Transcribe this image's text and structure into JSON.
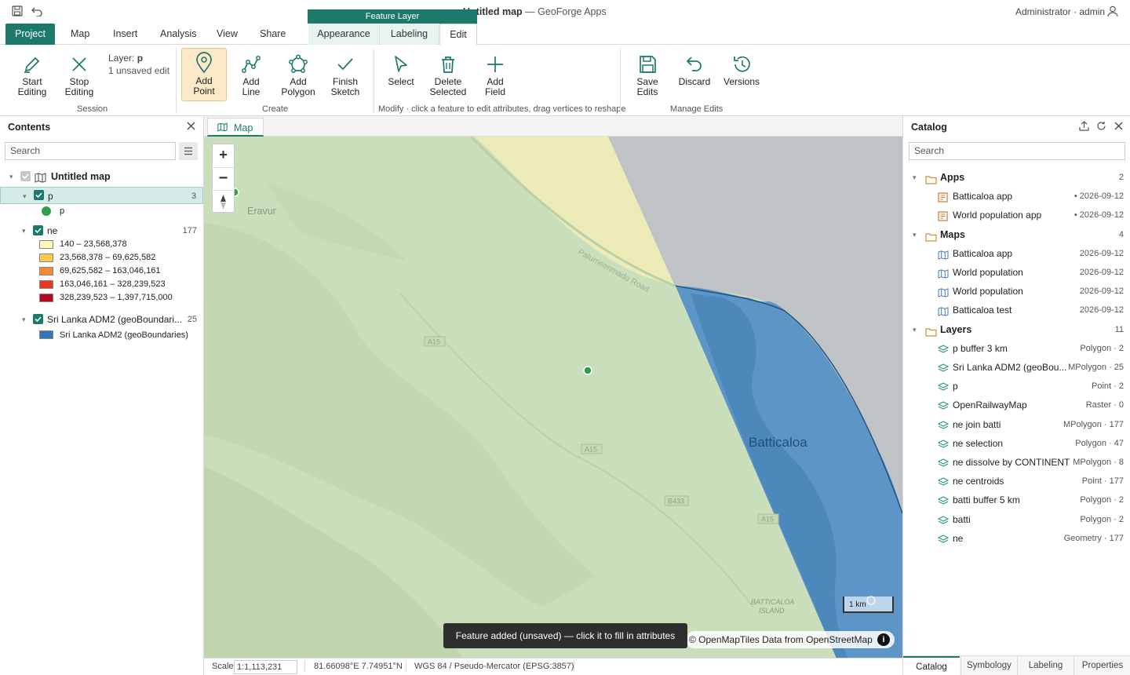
{
  "app": {
    "title_prefix": "Untitled map",
    "title_sep": " — ",
    "title_suffix": "GeoForge Apps",
    "user": "Administrator · admin"
  },
  "ribbon_tabs": [
    "Project",
    "Map",
    "Insert",
    "Analysis",
    "View",
    "Share"
  ],
  "contextual": {
    "header": "Feature Layer",
    "tabs": [
      "Appearance",
      "Labeling",
      "Edit"
    ]
  },
  "session": {
    "start": "Start\nEditing",
    "stop": "Stop\nEditing",
    "layer_label": "Layer: ",
    "layer_name": "p",
    "unsaved": "1 unsaved edit",
    "group": "Session"
  },
  "create": {
    "add_point": "Add\nPoint",
    "add_line": "Add\nLine",
    "add_polygon": "Add\nPolygon",
    "finish": "Finish\nSketch",
    "group": "Create"
  },
  "modify": {
    "select": "Select",
    "delete": "Delete\nSelected",
    "add_field": "Add\nField",
    "group": "Modify · click a feature to edit attributes, drag vertices to reshape"
  },
  "manage": {
    "save": "Save\nEdits",
    "discard": "Discard",
    "versions": "Versions",
    "group": "Manage Edits"
  },
  "contents": {
    "title": "Contents",
    "search_placeholder": "Search",
    "map_name": "Untitled map",
    "layer_p": {
      "name": "p",
      "count": "3",
      "legend": "p"
    },
    "layer_ne": {
      "name": "ne",
      "count": "177",
      "classes": [
        {
          "label": "140 – 23,568,378",
          "color": "#fff8b8"
        },
        {
          "label": "23,568,378 – 69,625,582",
          "color": "#fcc94d"
        },
        {
          "label": "69,625,582 – 163,046,161",
          "color": "#f58a35"
        },
        {
          "label": "163,046,161 – 328,239,523",
          "color": "#e8361e"
        },
        {
          "label": "328,239,523 – 1,397,715,000",
          "color": "#b4071f"
        }
      ]
    },
    "layer_adm": {
      "name": "Sri Lanka ADM2 (geoBoundari...",
      "count": "25",
      "legend": "Sri Lanka ADM2 (geoBoundaries)",
      "color": "#2f77b8"
    }
  },
  "map": {
    "tab": "Map",
    "places": {
      "eravur": "Eravur",
      "batticaloa": "Batticaloa",
      "island": "BATTICALOA\nISLAND"
    },
    "road": "Palumeenmadu Road",
    "shields": [
      "A15",
      "A15",
      "B433",
      "A15"
    ],
    "scale_bar": "1 km",
    "attribution_a": "© OpenMapTiles",
    "attribution_b": " Data from ",
    "attribution_c": "OpenStreetMap",
    "toast": "Feature added (unsaved) — click it to fill in attributes"
  },
  "status": {
    "scale_label": "Scale",
    "scale_value": "1:1,113,231",
    "coords": "81.66098°E 7.74951°N",
    "crs": "WGS 84 / Pseudo-Mercator (EPSG:3857)"
  },
  "catalog": {
    "title": "Catalog",
    "search_placeholder": "Search",
    "apps": {
      "label": "Apps",
      "count": "2",
      "items": [
        {
          "name": "Batticaloa app",
          "meta": "• 2026-09-12"
        },
        {
          "name": "World population app",
          "meta": "• 2026-09-12"
        }
      ]
    },
    "maps": {
      "label": "Maps",
      "count": "4",
      "items": [
        {
          "name": "Batticaloa app",
          "meta": "2026-09-12"
        },
        {
          "name": "World population",
          "meta": "2026-09-12"
        },
        {
          "name": "World population",
          "meta": "2026-09-12"
        },
        {
          "name": "Batticaloa test",
          "meta": "2026-09-12"
        }
      ]
    },
    "layers": {
      "label": "Layers",
      "count": "11",
      "items": [
        {
          "name": "p buffer 3 km",
          "meta": "Polygon · 2"
        },
        {
          "name": "Sri Lanka ADM2 (geoBou...",
          "meta": "MPolygon · 25"
        },
        {
          "name": "p",
          "meta": "Point · 2"
        },
        {
          "name": "OpenRailwayMap",
          "meta": "Raster · 0"
        },
        {
          "name": "ne join batti",
          "meta": "MPolygon · 177"
        },
        {
          "name": "ne selection",
          "meta": "Polygon · 47"
        },
        {
          "name": "ne dissolve by CONTINENT",
          "meta": "MPolygon · 8"
        },
        {
          "name": "ne centroids",
          "meta": "Point · 177"
        },
        {
          "name": "batti buffer 5 km",
          "meta": "Polygon · 2"
        },
        {
          "name": "batti",
          "meta": "Polygon · 2"
        },
        {
          "name": "ne",
          "meta": "Geometry · 177"
        }
      ]
    },
    "bottom_tabs": [
      "Catalog",
      "Symbology",
      "Labeling",
      "Properties"
    ]
  },
  "colors": {
    "accent": "#1d7a6b",
    "selected_row": "#d5ebe7",
    "land": "#c9deba",
    "buffer_yellow": "#ecebb8",
    "sea": "#c0c3c6",
    "adm_blue": "#5c95c6"
  }
}
